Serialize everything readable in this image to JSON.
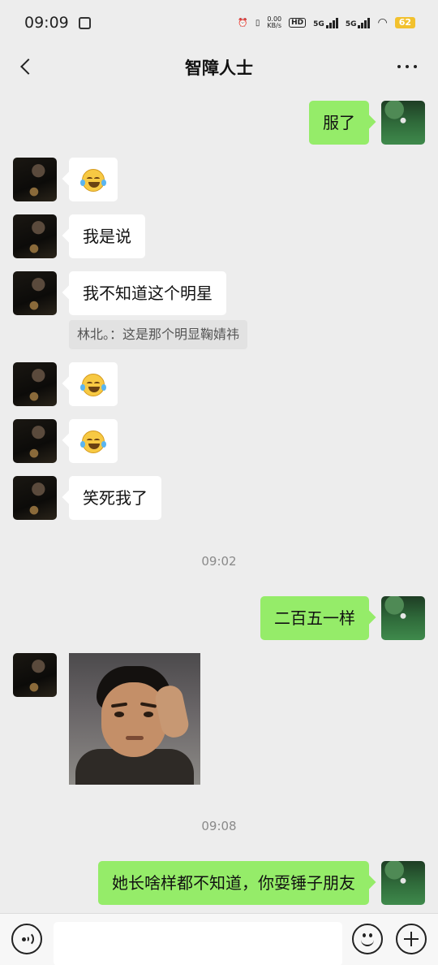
{
  "status_bar": {
    "time": "09:09",
    "net_speed_value": "0.00",
    "net_speed_unit": "KB/s",
    "hd_label": "HD",
    "sim1_label": "5G",
    "sim2_label": "5G",
    "battery": "62"
  },
  "header": {
    "title": "智障人士"
  },
  "messages": [
    {
      "sender": "self",
      "type": "text",
      "text": "服了"
    },
    {
      "sender": "other",
      "type": "emoji",
      "icon": "tears-of-joy-emoji"
    },
    {
      "sender": "other",
      "type": "text",
      "text": "我是说"
    },
    {
      "sender": "other",
      "type": "text",
      "text": "我不知道这个明星",
      "quote": "林北。：这是那个明显鞠婧祎"
    },
    {
      "sender": "other",
      "type": "emoji",
      "icon": "tears-of-joy-emoji"
    },
    {
      "sender": "other",
      "type": "emoji",
      "icon": "tears-of-joy-emoji"
    },
    {
      "sender": "other",
      "type": "text",
      "text": "笑死我了"
    },
    {
      "type": "time",
      "text": "09:02"
    },
    {
      "sender": "self",
      "type": "text",
      "text": "二百五一样"
    },
    {
      "sender": "other",
      "type": "sticker",
      "icon": "man-thinking-sticker"
    },
    {
      "type": "time",
      "text": "09:08"
    },
    {
      "sender": "self",
      "type": "text",
      "text": "她长啥样都不知道，你耍锤子朋友"
    }
  ],
  "input_bar": {
    "value": "",
    "voice_icon": "voice-icon",
    "emoji_icon": "smiley-icon",
    "plus_icon": "plus-icon"
  },
  "colors": {
    "background": "#ededed",
    "self_bubble": "#95ec69",
    "other_bubble": "#ffffff",
    "battery": "#f2c12e"
  }
}
